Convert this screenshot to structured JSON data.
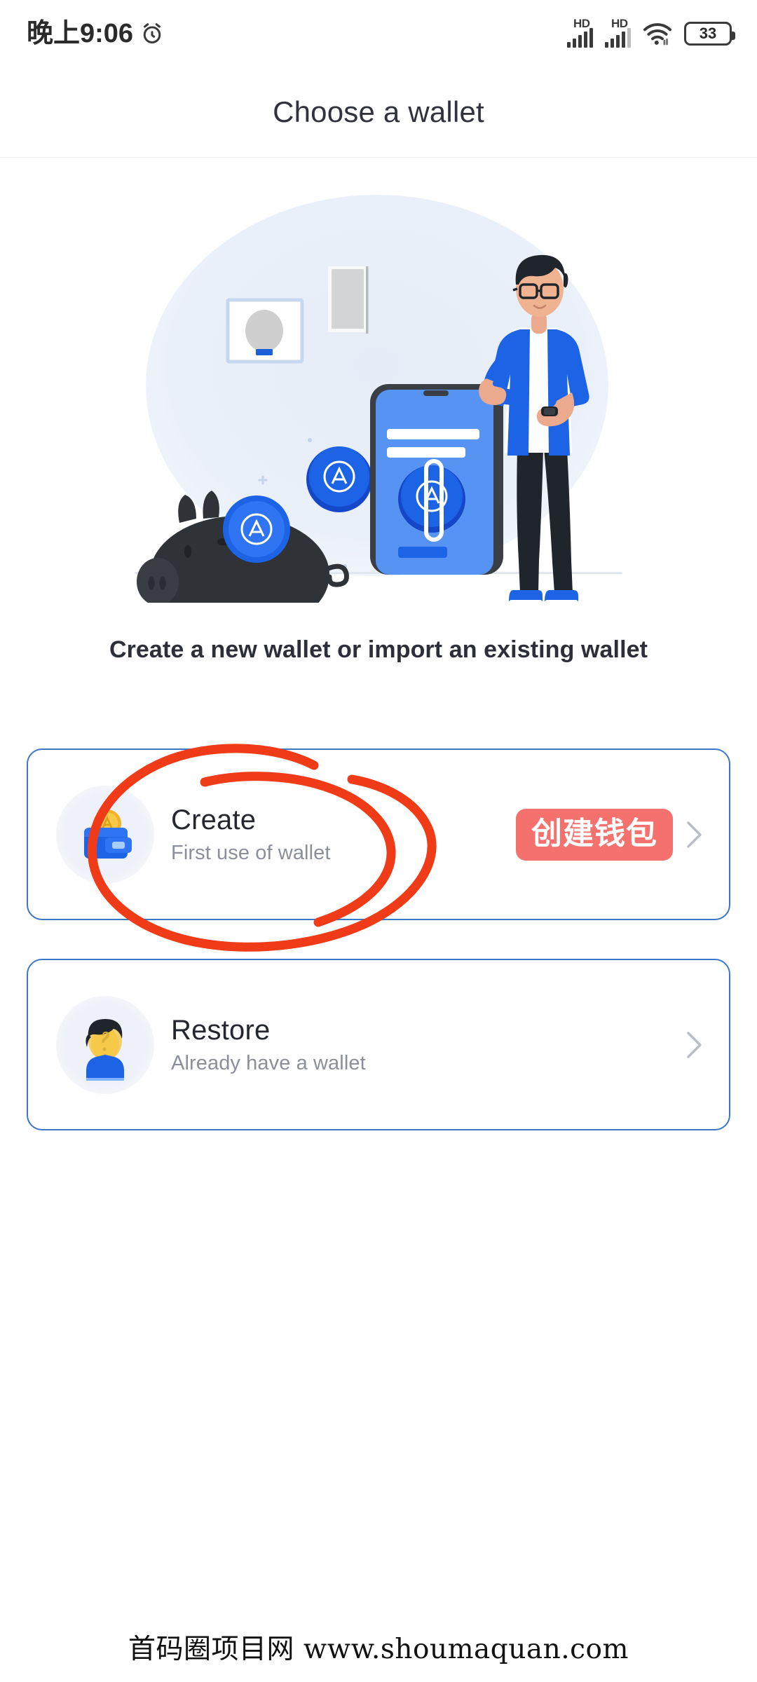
{
  "status_bar": {
    "time": "晚上9:06",
    "alarm_icon": "alarm-clock-icon",
    "signal_1": {
      "label": "HD",
      "bars": 5
    },
    "signal_2": {
      "label": "HD",
      "bars": 5
    },
    "wifi_icon": "wifi-icon",
    "battery_level": "33"
  },
  "header": {
    "title": "Choose a wallet"
  },
  "illustration": {
    "name": "wallet-onboarding-illustration",
    "elements": [
      "piggy-bank",
      "blue-coin-with-a-logo",
      "smartphone-with-login-screen",
      "man-with-glasses-blue-shirt",
      "framed-wall-picture",
      "portrait-wall-frame"
    ]
  },
  "subtitle": "Create a new wallet or import an existing wallet",
  "options": [
    {
      "id": "create",
      "icon": "wallet-with-coin-icon",
      "title": "Create",
      "subtitle": "First use of wallet",
      "badge": "创建钱包",
      "badge_color": "#f4716e",
      "chevron": "chevron-right-icon",
      "annotated": true
    },
    {
      "id": "restore",
      "icon": "person-question-avatar-icon",
      "title": "Restore",
      "subtitle": "Already have a wallet",
      "badge": null,
      "chevron": "chevron-right-icon",
      "annotated": false
    }
  ],
  "annotation": {
    "name": "red-circle-annotation",
    "color": "#ef3b17",
    "target": "create"
  },
  "watermark": "首码圈项目网 www.shoumaquan.com",
  "colors": {
    "card_border": "#3b77c4",
    "badge_red": "#f4716e",
    "annotation_red": "#ef3b17",
    "title_text": "#30333c",
    "sub_text": "#8b8f99",
    "background": "#ffffff"
  }
}
